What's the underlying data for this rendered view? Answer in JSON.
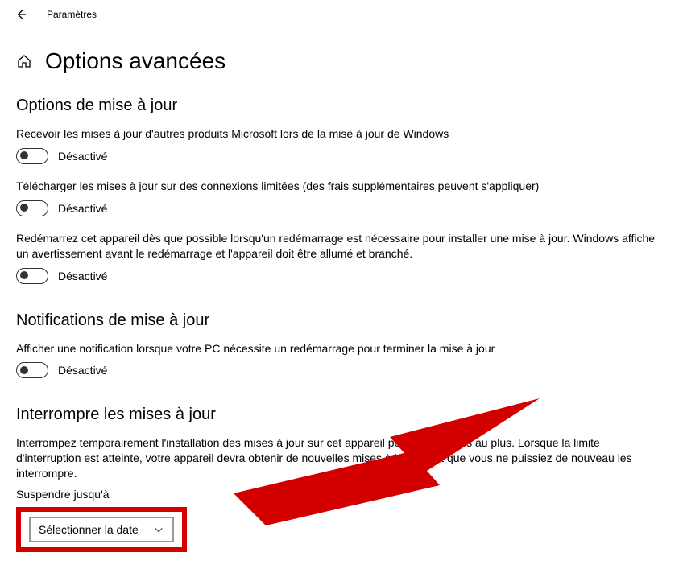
{
  "titlebar": {
    "label": "Paramètres"
  },
  "page": {
    "title": "Options avancées"
  },
  "sections": {
    "update_options": {
      "heading": "Options de mise à jour",
      "settings": [
        {
          "desc": "Recevoir les mises à jour d'autres produits Microsoft lors de la mise à jour de Windows",
          "state_label": "Désactivé"
        },
        {
          "desc": "Télécharger les mises à jour sur des connexions limitées (des frais supplémentaires peuvent s'appliquer)",
          "state_label": "Désactivé"
        },
        {
          "desc": "Redémarrez cet appareil dès que possible lorsqu'un redémarrage est nécessaire pour installer une mise à jour. Windows affiche un avertissement avant le redémarrage et l'appareil doit être allumé et branché.",
          "state_label": "Désactivé"
        }
      ]
    },
    "update_notifications": {
      "heading": "Notifications de mise à jour",
      "settings": [
        {
          "desc": "Afficher une notification lorsque votre PC nécessite un redémarrage pour terminer la mise à jour",
          "state_label": "Désactivé"
        }
      ]
    },
    "pause_updates": {
      "heading": "Interrompre les mises à jour",
      "desc": "Interrompez temporairement l'installation des mises à jour sur cet appareil pendant 35 jours au plus. Lorsque la limite d'interruption est atteinte, votre appareil devra obtenir de nouvelles mises à jour avant que vous ne puissiez de nouveau les interrompre.",
      "pause_until_label": "Suspendre jusqu'à",
      "date_select_label": "Sélectionner la date"
    }
  },
  "colors": {
    "highlight": "#d30000"
  }
}
